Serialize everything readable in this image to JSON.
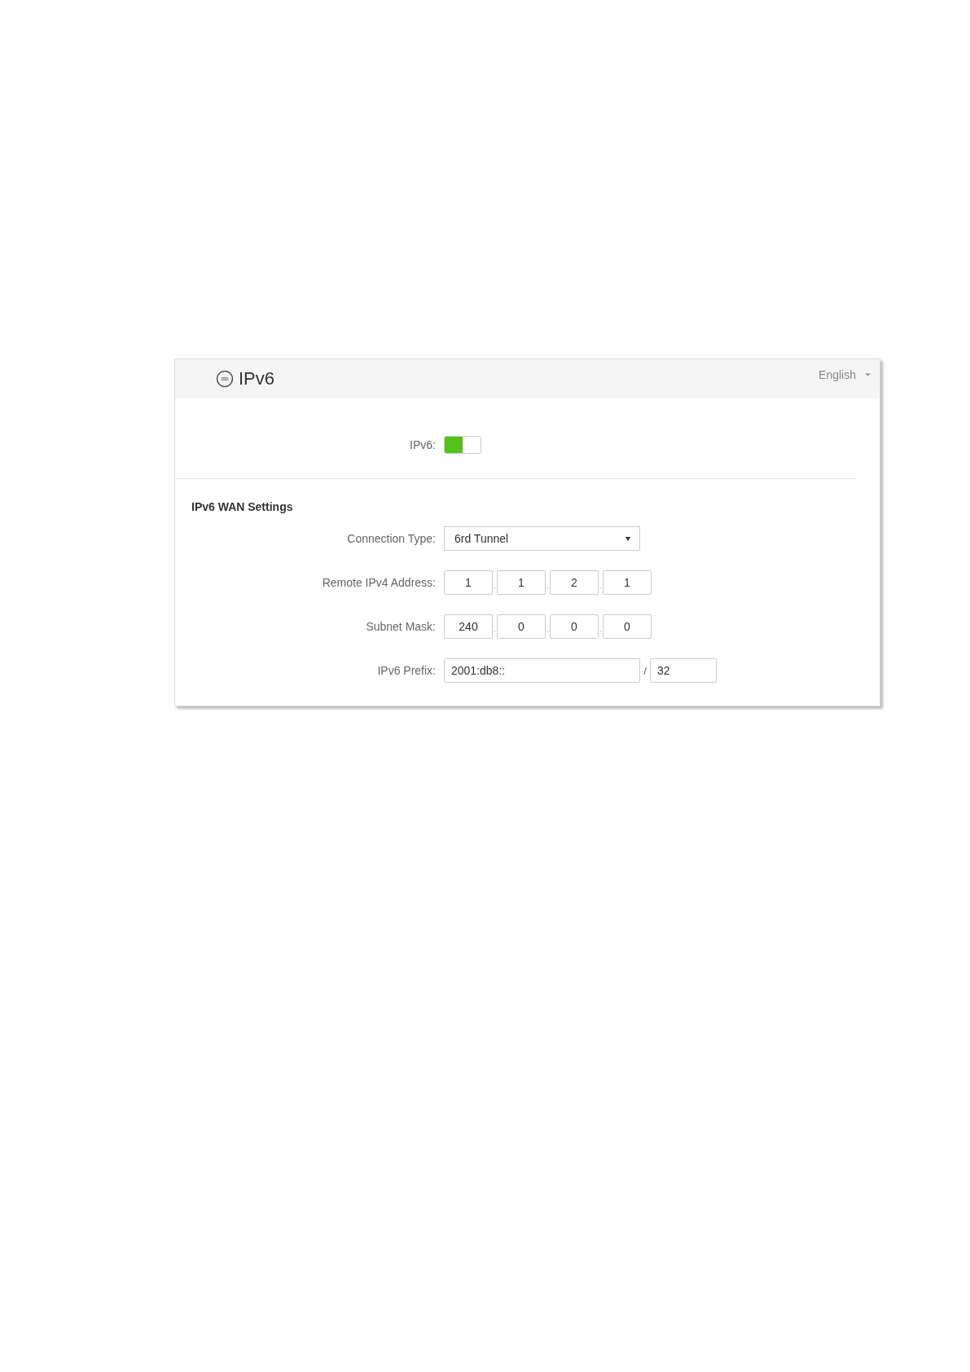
{
  "header": {
    "title": "IPv6",
    "language": "English"
  },
  "ipv6_toggle": {
    "label": "IPv6:",
    "on": true
  },
  "section": {
    "title": "IPv6 WAN Settings"
  },
  "fields": [
    {
      "kind": "select",
      "label": "Connection Type:",
      "value": "6rd Tunnel"
    },
    {
      "kind": "octets",
      "label": "Remote IPv4 Address:",
      "separator": ".",
      "values": [
        "1",
        "1",
        "2",
        "1"
      ]
    },
    {
      "kind": "octets",
      "label": "Subnet Mask:",
      "separator": ".",
      "values": [
        "240",
        "0",
        "0",
        "0"
      ]
    },
    {
      "kind": "prefix",
      "label": "IPv6 Prefix:",
      "value": "2001:db8::",
      "separator": "/",
      "length": "32"
    }
  ]
}
